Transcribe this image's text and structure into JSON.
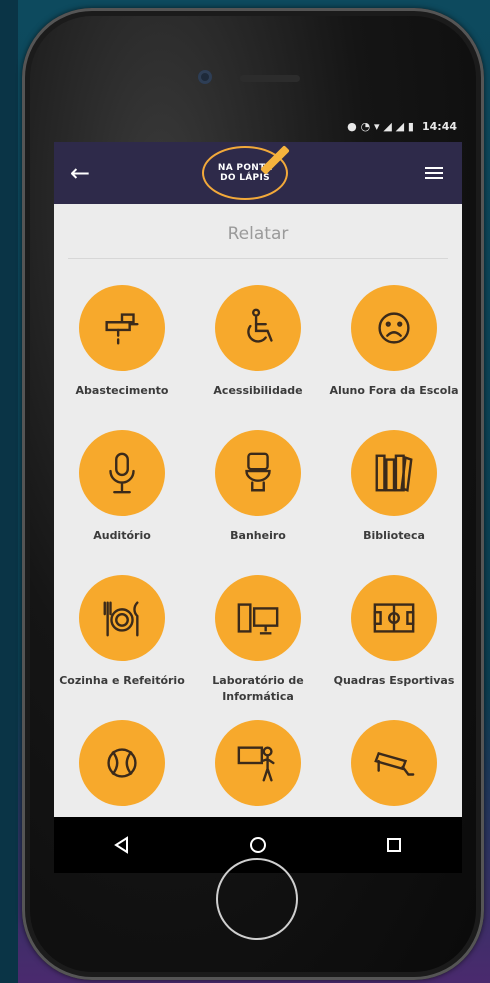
{
  "status_bar": {
    "time": "14:44"
  },
  "app_bar": {
    "back_icon": "arrow-left",
    "logo_line1": "NA PONTA",
    "logo_line2": "DO LÁPIS",
    "menu_icon": "hamburger"
  },
  "section_title": "Relatar",
  "categories": [
    {
      "label": "Abastecimento",
      "icon": "faucet"
    },
    {
      "label": "Acessibilidade",
      "icon": "wheelchair"
    },
    {
      "label": "Aluno Fora da Escola",
      "icon": "sad-face"
    },
    {
      "label": "Auditório",
      "icon": "microphone"
    },
    {
      "label": "Banheiro",
      "icon": "toilet"
    },
    {
      "label": "Biblioteca",
      "icon": "books"
    },
    {
      "label": "Cozinha e Refeitório",
      "icon": "plate-cutlery"
    },
    {
      "label": "Laboratório de Informática",
      "icon": "computer"
    },
    {
      "label": "Quadras Esportivas",
      "icon": "sports-court"
    },
    {
      "label": "",
      "icon": "ball"
    },
    {
      "label": "",
      "icon": "teacher-board"
    },
    {
      "label": "",
      "icon": "security-camera"
    }
  ],
  "colors": {
    "accent": "#f7a92c",
    "app_bar": "#2e2a4a",
    "screen_bg": "#ececec"
  }
}
